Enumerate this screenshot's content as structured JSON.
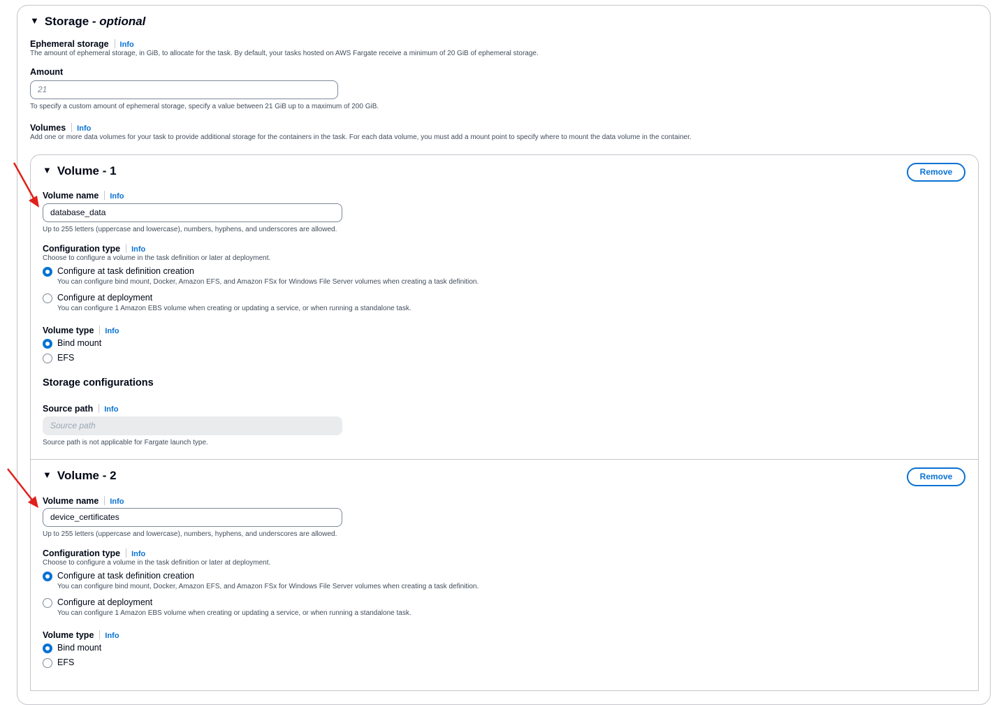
{
  "storage": {
    "title": "Storage",
    "title_suffix": "- optional",
    "ephemeral": {
      "label": "Ephemeral storage",
      "info": "Info",
      "description": "The amount of ephemeral storage, in GiB, to allocate for the task. By default, your tasks hosted on AWS Fargate receive a minimum of 20 GiB of ephemeral storage."
    },
    "amount": {
      "label": "Amount",
      "placeholder": "21",
      "hint": "To specify a custom amount of ephemeral storage, specify a value between 21 GiB up to a maximum of 200 GiB."
    },
    "volumes": {
      "label": "Volumes",
      "info": "Info",
      "description": "Add one or more data volumes for your task to provide additional storage for the containers in the task. For each data volume, you must add a mount point to specify where to mount the data volume in the container."
    }
  },
  "volume_list": [
    {
      "title": "Volume - 1",
      "remove_label": "Remove",
      "name_label": "Volume name",
      "info": "Info",
      "name_value": "database_data",
      "name_hint": "Up to 255 letters (uppercase and lowercase), numbers, hyphens, and underscores are allowed.",
      "config_label": "Configuration type",
      "config_desc": "Choose to configure a volume in the task definition or later at deployment.",
      "config_options": [
        {
          "label": "Configure at task definition creation",
          "desc": "You can configure bind mount, Docker, Amazon EFS, and Amazon FSx for Windows File Server volumes when creating a task definition.",
          "selected": true
        },
        {
          "label": "Configure at deployment",
          "desc": "You can configure 1 Amazon EBS volume when creating or updating a service, or when running a standalone task.",
          "selected": false
        }
      ],
      "type_label": "Volume type",
      "type_options": [
        {
          "label": "Bind mount",
          "selected": true
        },
        {
          "label": "EFS",
          "selected": false
        }
      ],
      "storage_config_title": "Storage configurations",
      "source_path_label": "Source path",
      "source_path_placeholder": "Source path",
      "source_path_hint": "Source path is not applicable for Fargate launch type."
    },
    {
      "title": "Volume - 2",
      "remove_label": "Remove",
      "name_label": "Volume name",
      "info": "Info",
      "name_value": "device_certificates",
      "name_hint": "Up to 255 letters (uppercase and lowercase), numbers, hyphens, and underscores are allowed.",
      "config_label": "Configuration type",
      "config_desc": "Choose to configure a volume in the task definition or later at deployment.",
      "config_options": [
        {
          "label": "Configure at task definition creation",
          "desc": "You can configure bind mount, Docker, Amazon EFS, and Amazon FSx for Windows File Server volumes when creating a task definition.",
          "selected": true
        },
        {
          "label": "Configure at deployment",
          "desc": "You can configure 1 Amazon EBS volume when creating or updating a service, or when running a standalone task.",
          "selected": false
        }
      ],
      "type_label": "Volume type",
      "type_options": [
        {
          "label": "Bind mount",
          "selected": true
        },
        {
          "label": "EFS",
          "selected": false
        }
      ]
    }
  ],
  "colors": {
    "accent": "#0972d3",
    "annotation_arrow": "#e0201b",
    "text": "#000716",
    "muted": "#414d5c"
  }
}
